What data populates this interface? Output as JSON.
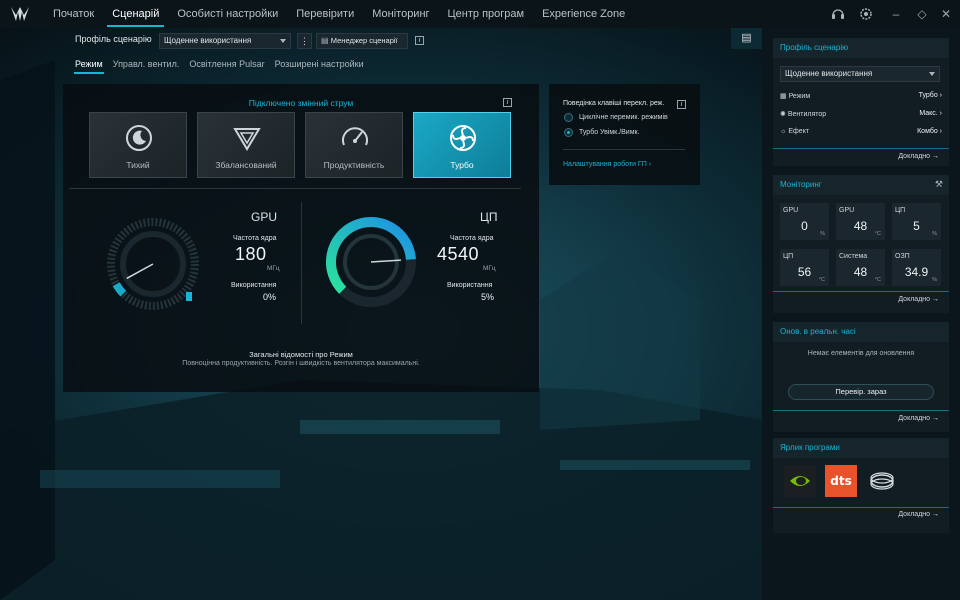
{
  "topnav": {
    "tabs": [
      "Початок",
      "Сценарій",
      "Особисті настройки",
      "Перевірити",
      "Моніторинг",
      "Центр програм",
      "Experience Zone"
    ],
    "active_tab": "Сценарій"
  },
  "scenario": {
    "profile_label": "Профіль сценарію",
    "profile_value": "Щоденне використання",
    "manager_label": "Менеджер сценарії",
    "subtabs": [
      "Режим",
      "Управл. вентил.",
      "Освітлення Pulsar",
      "Розширені настройки"
    ],
    "active_subtab": "Режим"
  },
  "mode_panel": {
    "power_note": "Підключено змінний струм",
    "modes": [
      {
        "label": "Тихий",
        "icon": "moon-icon"
      },
      {
        "label": "Збалансований",
        "icon": "balanced-icon"
      },
      {
        "label": "Продуктивність",
        "icon": "speedometer-icon"
      },
      {
        "label": "Турбо",
        "icon": "turbo-fan-icon"
      }
    ],
    "active_mode": "Турбо",
    "gpu": {
      "title": "GPU",
      "freq_label": "Частота ядра",
      "freq_value": "180",
      "freq_unit": "МГц",
      "usage_label": "Використання",
      "usage_value": "0%",
      "usage_fraction": 0.0,
      "freq_fraction": 0.06
    },
    "cpu": {
      "title": "ЦП",
      "freq_label": "Частота ядра",
      "freq_value": "4540",
      "freq_unit": "МГц",
      "usage_label": "Використання",
      "usage_value": "5%",
      "usage_fraction": 0.05,
      "freq_fraction": 0.82
    },
    "footer_title": "Загальні відомості про Режим",
    "footer_desc": "Повноцінна продуктивність. Розгін і швидкість вентилятора максимальні."
  },
  "key_behavior": {
    "title": "Поведінка клавіші перекл. реж.",
    "options": [
      "Циклічне перемик. режимів",
      "Турбо Увімк./Вимк."
    ],
    "selected": "Турбо Увімк./Вимк.",
    "link": "Налаштування роботи ГП"
  },
  "sidebar": {
    "profile": {
      "title": "Профіль сценарію",
      "value": "Щоденне використання",
      "rows": [
        {
          "icon": "mode-icon",
          "label": "Режим",
          "value": "Турбо"
        },
        {
          "icon": "fan-icon",
          "label": "Вентилятор",
          "value": "Макс."
        },
        {
          "icon": "effect-icon",
          "label": "Ефект",
          "value": "Комбо"
        }
      ],
      "more": "Докладно"
    },
    "monitoring": {
      "title": "Моніторинг",
      "tiles": [
        {
          "label": "GPU",
          "value": "0",
          "unit": "%"
        },
        {
          "label": "GPU",
          "value": "48",
          "unit": "°C"
        },
        {
          "label": "ЦП",
          "value": "5",
          "unit": "%"
        },
        {
          "label": "ЦП",
          "value": "56",
          "unit": "°C"
        },
        {
          "label": "Система",
          "value": "48",
          "unit": "°C"
        },
        {
          "label": "ОЗП",
          "value": "34.9",
          "unit": "%"
        }
      ],
      "more": "Докладно"
    },
    "updates": {
      "title": "Онов. в реальн. часі",
      "empty": "Немає елементів для оновлення",
      "button": "Перевір. зараз",
      "more": "Докладно"
    },
    "shortcuts": {
      "title": "Ярлик програми",
      "apps": [
        {
          "icon": "nvidia-icon",
          "label": ""
        },
        {
          "icon": "dts-icon",
          "label": "dts"
        },
        {
          "icon": "thx-icon",
          "label": ""
        }
      ],
      "more": "Докладно"
    }
  },
  "colors": {
    "accent": "#19b5d4",
    "gauge_start": "#2be39a",
    "gauge_end": "#1d8fe8"
  }
}
